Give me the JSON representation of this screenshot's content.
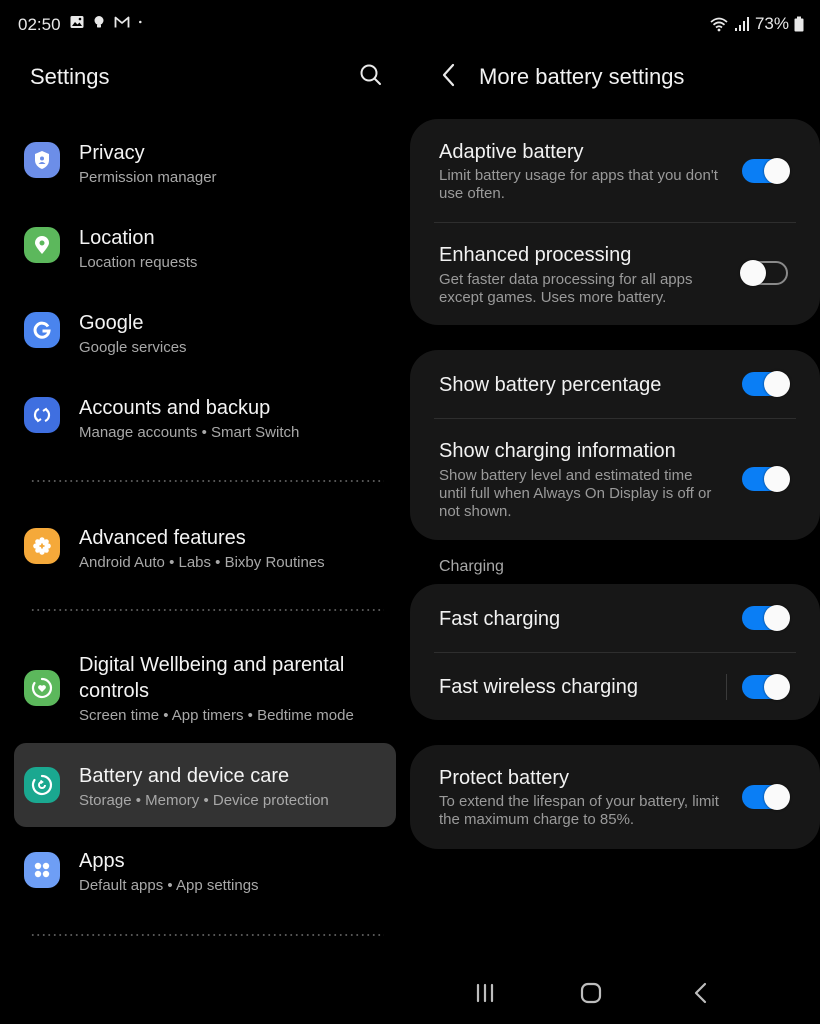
{
  "status_bar": {
    "time": "02:50",
    "notification_icons": [
      "gallery-icon",
      "bulb-icon",
      "gmail-icon",
      "dot-icon"
    ],
    "right_icons": [
      "wifi-icon",
      "signal-icon"
    ],
    "battery_text": "73%"
  },
  "left_pane": {
    "title": "Settings",
    "search_icon": "search-icon",
    "items": [
      {
        "title": "Privacy",
        "subtitle": "Permission manager",
        "icon": "shield-user-icon",
        "color": "#6c8ee8"
      },
      {
        "title": "Location",
        "subtitle": "Location requests",
        "icon": "location-pin-icon",
        "color": "#5cb85c"
      },
      {
        "title": "Google",
        "subtitle": "Google services",
        "icon": "google-g-icon",
        "color": "#4a84ee"
      },
      {
        "title": "Accounts and backup",
        "subtitle": "Manage accounts  •  Smart Switch",
        "icon": "sync-icon",
        "color": "#3f6fe0"
      },
      {
        "title": "Advanced features",
        "subtitle": "Android Auto  •  Labs  •  Bixby Routines",
        "icon": "gear-plus-icon",
        "color": "#f5a93a"
      },
      {
        "title": "Digital Wellbeing and parental controls",
        "subtitle": "Screen time  •  App timers  •  Bedtime mode",
        "icon": "wellbeing-heart-icon",
        "color": "#5cb85c"
      },
      {
        "title": "Battery and device care",
        "subtitle": "Storage  •  Memory  •  Device protection",
        "icon": "device-care-icon",
        "color": "#1aa890",
        "selected": true
      },
      {
        "title": "Apps",
        "subtitle": "Default apps  •  App settings",
        "icon": "apps-grid-icon",
        "color": "#6e9ef5"
      }
    ]
  },
  "right_pane": {
    "title": "More battery settings",
    "back_icon": "back-chevron-icon",
    "groups": [
      {
        "rows": [
          {
            "title": "Adaptive battery",
            "description": "Limit battery usage for apps that you don't use often.",
            "enabled": true
          },
          {
            "title": "Enhanced processing",
            "description": "Get faster data processing for all apps except games. Uses more battery.",
            "enabled": false
          }
        ]
      },
      {
        "rows": [
          {
            "title": "Show battery percentage",
            "description": "",
            "enabled": true
          },
          {
            "title": "Show charging information",
            "description": "Show battery level and estimated time until full when Always On Display is off or not shown.",
            "enabled": true
          }
        ]
      },
      {
        "section_label": "Charging",
        "rows": [
          {
            "title": "Fast charging",
            "description": "",
            "enabled": true
          },
          {
            "title": "Fast wireless charging",
            "description": "",
            "enabled": true
          }
        ]
      },
      {
        "rows": [
          {
            "title": "Protect battery",
            "description": "To extend the lifespan of your battery, limit the maximum charge to 85%.",
            "enabled": true
          }
        ]
      }
    ]
  },
  "nav_bar": {
    "buttons": [
      {
        "name": "recent-apps",
        "icon": "recents-icon"
      },
      {
        "name": "home",
        "icon": "home-icon"
      },
      {
        "name": "back",
        "icon": "back-icon"
      }
    ]
  },
  "colors": {
    "accent": "#0a7ef5",
    "card_background": "#171717",
    "selected_background": "#333333"
  }
}
